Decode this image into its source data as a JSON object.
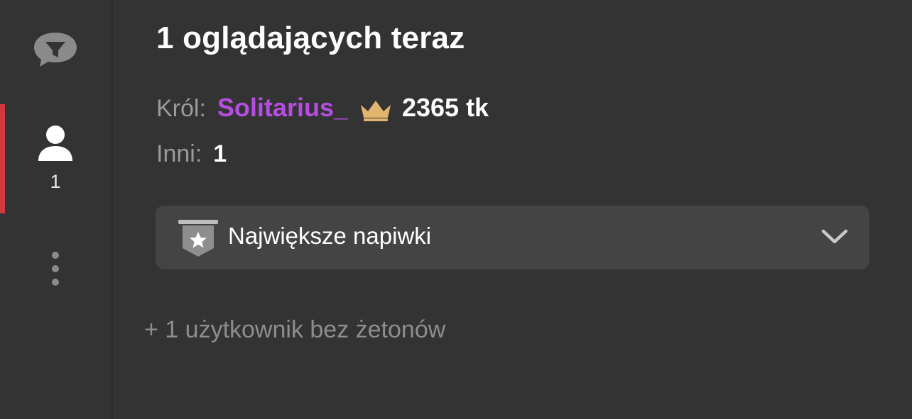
{
  "sidebar": {
    "chat_icon": "chat-filter-icon",
    "users_icon": "user-icon",
    "users_count": "1",
    "more_icon": "more-vertical-icon",
    "active_color": "#d03a3e"
  },
  "main": {
    "title": "1 oglądających teraz",
    "king_label": "Król:",
    "king_name": "Solitarius_",
    "king_name_color": "#b54ee0",
    "crown_icon": "crown-icon",
    "crown_color": "#e2b56f",
    "king_tokens": "2365 tk",
    "others_label": "Inni:",
    "others_count": "1",
    "dropdown": {
      "icon": "ribbon-star-icon",
      "label": "Największe napiwki",
      "chevron": "chevron-down-icon"
    },
    "no_tokens_text": "+ 1 użytkownik bez żetonów"
  }
}
